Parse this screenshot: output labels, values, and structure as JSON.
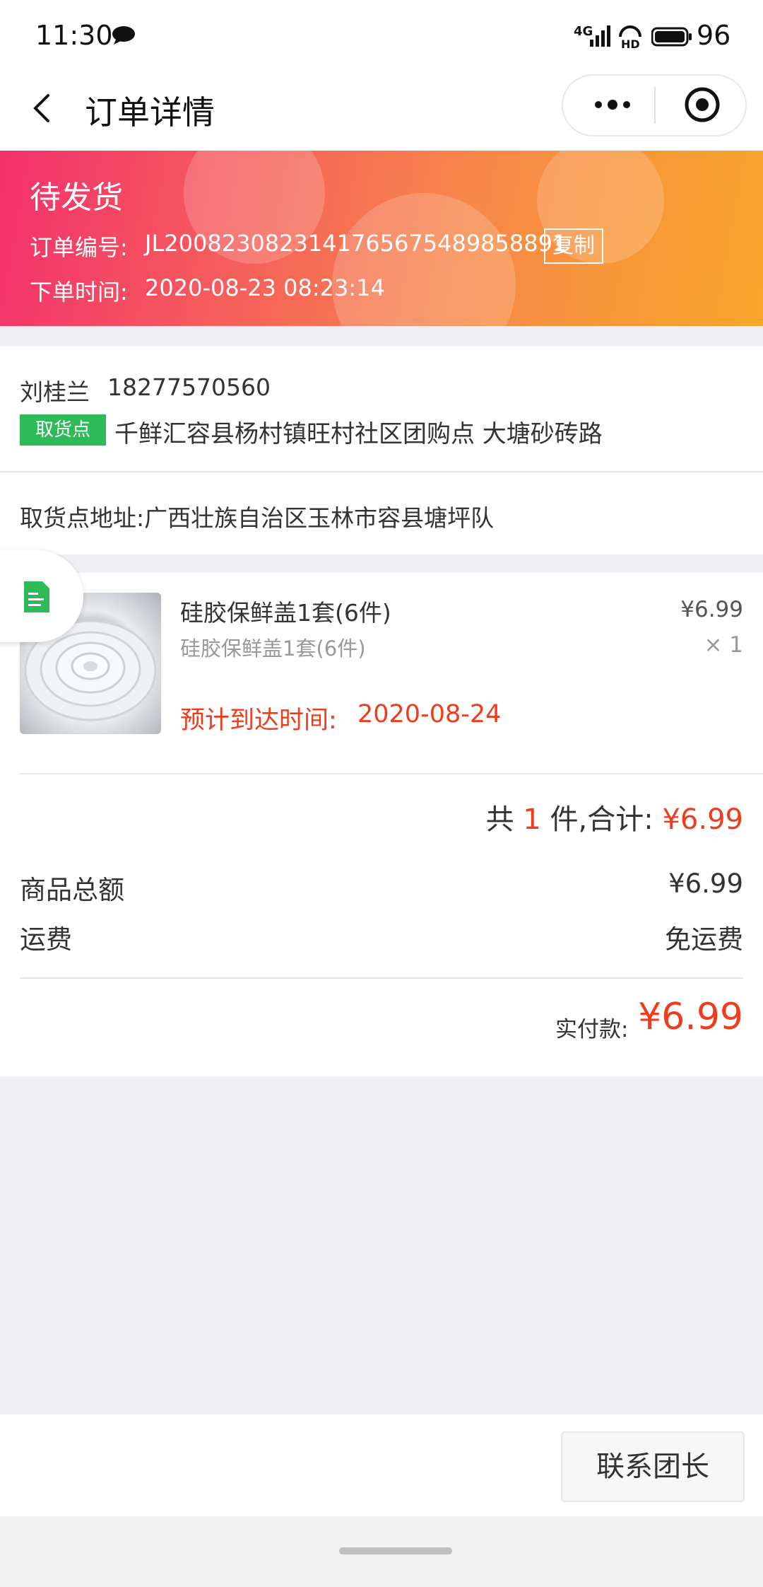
{
  "status_bar": {
    "time": "11:30",
    "network": "4G",
    "battery": "96",
    "icons": [
      "message-icon",
      "signal-icon",
      "hd-icon",
      "battery-icon"
    ]
  },
  "nav": {
    "title": "订单详情",
    "icons": [
      "back-icon",
      "more-icon",
      "target-icon"
    ]
  },
  "order": {
    "status": "待发货",
    "number_label": "订单编号:",
    "number": "JL2008230823141765675489858891",
    "copy_label": "复制",
    "time_label": "下单时间:",
    "time": "2020-08-23 08:23:14"
  },
  "customer": {
    "name": "刘桂兰",
    "phone": "18277570560",
    "pickup_badge": "取货点",
    "pickup_name": "千鲜汇容县杨村镇旺村社区团购点 大塘砂砖路",
    "pickup_address": "取货点地址:广西壮族自治区玉林市容县塘坪队"
  },
  "product": {
    "name": "硅胶保鲜盖1套(6件)",
    "spec": "硅胶保鲜盖1套(6件)",
    "price": "¥6.99",
    "qty": "× 1",
    "eta_label": "预计到达时间:",
    "eta": "2020-08-24"
  },
  "summary": {
    "count_prefix": "共",
    "count": "1",
    "count_suffix": "件,合计:",
    "total": "¥6.99",
    "subtotal_label": "商品总额",
    "subtotal": "¥6.99",
    "shipping_label": "运费",
    "shipping": "免运费",
    "paid_label": "实付款:",
    "paid": "¥6.99"
  },
  "actions": {
    "contact_label": "联系团长"
  },
  "colors": {
    "accent_red": "#f03c1d",
    "badge_green": "#2fba5a",
    "banner_start": "#f4306c",
    "banner_end": "#f9a62a"
  }
}
